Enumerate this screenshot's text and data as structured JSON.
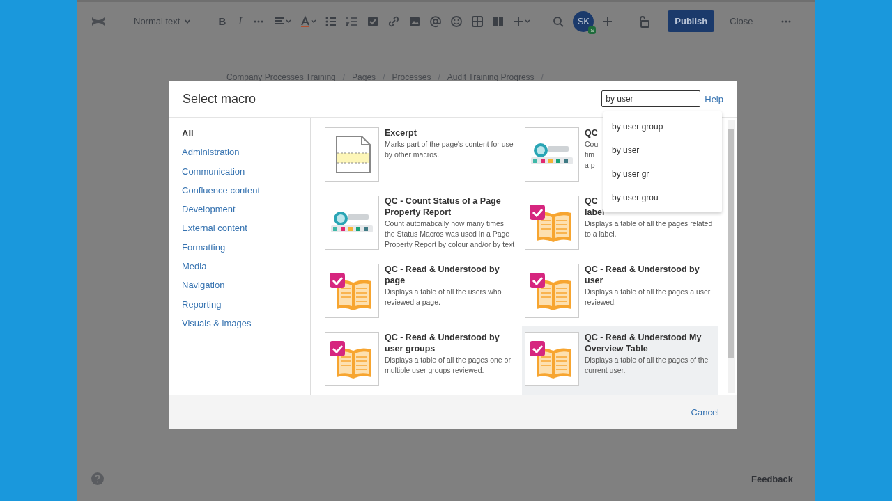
{
  "toolbar": {
    "text_style": "Normal text",
    "format_buttons": [
      {
        "kind": "bold",
        "text": "B"
      },
      {
        "kind": "italic",
        "text": "I"
      }
    ],
    "avatar": {
      "initials": "SK",
      "badge": "S"
    },
    "buttons": [
      {
        "kind": "primary",
        "label": "Publish"
      },
      {
        "kind": "plain",
        "label": "Close"
      }
    ]
  },
  "breadcrumb": [
    {
      "kind": "link",
      "text": "Company Processes Training"
    },
    {
      "kind": "separator",
      "text": "/"
    },
    {
      "kind": "link",
      "text": "Pages"
    },
    {
      "kind": "separator",
      "text": "/"
    },
    {
      "kind": "link",
      "text": "Processes"
    },
    {
      "kind": "separator",
      "text": "/"
    },
    {
      "kind": "link",
      "text": "Audit Training Progress"
    },
    {
      "kind": "separator",
      "text": "/"
    }
  ],
  "dialog": {
    "title": "Select macro",
    "search": {
      "value": "by user"
    },
    "help": "Help",
    "suggestions": [
      "by user group",
      "by user",
      "by user gr",
      "by user grou"
    ],
    "categories": [
      {
        "label": "All",
        "selected": true
      },
      {
        "label": "Administration",
        "selected": false
      },
      {
        "label": "Communication",
        "selected": false
      },
      {
        "label": "Confluence content",
        "selected": false
      },
      {
        "label": "Development",
        "selected": false
      },
      {
        "label": "External content",
        "selected": false
      },
      {
        "label": "Formatting",
        "selected": false
      },
      {
        "label": "Media",
        "selected": false
      },
      {
        "label": "Navigation",
        "selected": false
      },
      {
        "label": "Reporting",
        "selected": false
      },
      {
        "label": "Visuals & images",
        "selected": false
      }
    ],
    "macros": [
      {
        "kind": "excerpt",
        "title": "Excerpt",
        "description": "Marks part of the page's content for use by other macros.",
        "highlighted": false
      },
      {
        "kind": "status",
        "title": "QC",
        "description": "Cou\ntim\na p",
        "highlighted": false
      },
      {
        "kind": "status",
        "title": "QC - Count Status of a Page Property Report",
        "description": "Count automatically how many times the Status Macros was used in a Page Property Report by colour and/or by text",
        "highlighted": false
      },
      {
        "kind": "book",
        "title": "QC\nlabel",
        "description": "Displays a table of all the pages related to a label.",
        "highlighted": false
      },
      {
        "kind": "book",
        "title": "QC - Read & Understood by page",
        "description": "Displays a table of all the users who reviewed a page.",
        "highlighted": false
      },
      {
        "kind": "book",
        "title": "QC - Read & Understood by user",
        "description": "Displays a table of all the pages a user reviewed.",
        "highlighted": false
      },
      {
        "kind": "book",
        "title": "QC - Read & Understood by user groups",
        "description": "Displays a table of all the pages one or multiple user groups reviewed.",
        "highlighted": false
      },
      {
        "kind": "book",
        "title": "QC - Read & Understood My Overview Table",
        "description": "Displays a table of all the pages of the current user.",
        "highlighted": true
      }
    ],
    "cancel": "Cancel"
  },
  "footer": {
    "feedback": "Feedback"
  }
}
